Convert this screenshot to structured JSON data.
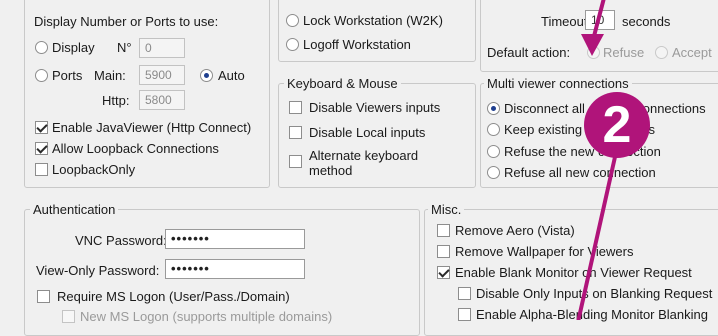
{
  "ports": {
    "title": "Display Number or Ports to use:",
    "display_label": "Display",
    "n_label": "N°",
    "display_value": "0",
    "ports_label": "Ports",
    "main_label": "Main:",
    "main_value": "5900",
    "auto_label": "Auto",
    "http_label": "Http:",
    "http_value": "5800",
    "enable_java_label": "Enable JavaViewer (Http Connect)",
    "allow_loopback_label": "Allow Loopback Connections",
    "loopback_only_label": "LoopbackOnly"
  },
  "disconnect": {
    "lock_label": "Lock Workstation (W2K)",
    "logoff_label": "Logoff Workstation"
  },
  "query": {
    "timeout_label": "Timeout",
    "timeout_value": "10",
    "seconds_label": "seconds",
    "default_action_label": "Default action:",
    "refuse_label": "Refuse",
    "accept_label": "Accept"
  },
  "keyboard": {
    "title": "Keyboard & Mouse",
    "disable_viewers_label": "Disable Viewers inputs",
    "disable_local_label": "Disable Local inputs",
    "alternate_line1": "Alternate keyboard",
    "alternate_line2": "method"
  },
  "multi": {
    "title": "Multi viewer connections",
    "disconnect_all_label": "Disconnect all existing connections",
    "keep_existing_label": "Keep existing connections",
    "refuse_new_label": "Refuse the new connection",
    "refuse_all_label": "Refuse all new connection"
  },
  "auth": {
    "title": "Authentication",
    "vnc_password_label": "VNC Password:",
    "vnc_password_value": "•••••••",
    "viewonly_password_label": "View-Only Password:",
    "viewonly_password_value": "•••••••",
    "require_ms_logon_label": "Require MS Logon  (User/Pass./Domain)",
    "new_ms_logon_label": "New MS Logon (supports multiple domains)"
  },
  "misc": {
    "title": "Misc.",
    "remove_aero_label": "Remove Aero (Vista)",
    "remove_wallpaper_label": "Remove Wallpaper for Viewers",
    "enable_blank_label": "Enable Blank Monitor on Viewer Request",
    "disable_only_inputs_label": "Disable Only Inputs on Blanking Request",
    "enable_alpha_label": "Enable Alpha-Blending Monitor Blanking"
  },
  "annotation": {
    "badge_number": "2",
    "color": "#b0147a"
  }
}
